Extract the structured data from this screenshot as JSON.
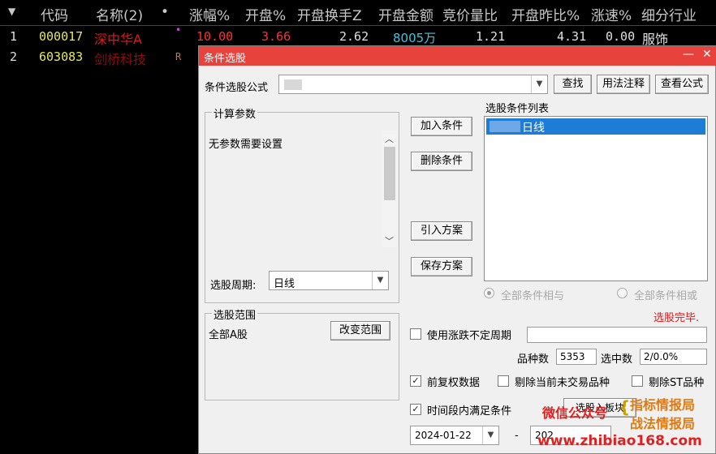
{
  "table": {
    "columns": [
      "代码",
      "名称(2)",
      "•",
      "涨幅%",
      "开盘%",
      "开盘换手Z",
      "开盘金额",
      "竞价量比",
      "开盘昨比%",
      "涨速%",
      "细分行业"
    ],
    "rows": [
      {
        "index": "1",
        "code": "000017",
        "name": "深中华A",
        "flag": "•",
        "change": "10.00",
        "open": "3.66",
        "turnover": "2.62",
        "amount": "8005万",
        "ratio": "1.21",
        "open_prev": "4.31",
        "speed": "0.00",
        "industry": "服饰"
      },
      {
        "index": "2",
        "code": "603083",
        "name": "剑桥科技",
        "flag": "R",
        "change": "",
        "open": "",
        "turnover": "",
        "amount": "",
        "ratio": "",
        "open_prev": "",
        "speed": "",
        "industry": ""
      }
    ],
    "sort_marker": "▼",
    "colors": {
      "code": "#e8e85a",
      "name1": "#e01818",
      "name2": "#8a0e0e",
      "change": "#ff3030",
      "amount": "#3ac8e0",
      "neutral": "#e0e0e0"
    }
  },
  "dialog": {
    "title": "条件选股",
    "minimize": "—",
    "close": "✕",
    "formula_label": "条件选股公式",
    "formula_value": "",
    "find_btn": "查找",
    "usage_btn": "用法注释",
    "view_btn": "查看公式",
    "params_title": "计算参数",
    "params_text": "无参数需要设置",
    "period_label": "选股周期:",
    "period_value": "日线",
    "add_btn": "加入条件",
    "del_btn": "删除条件",
    "import_btn": "引入方案",
    "save_btn": "保存方案",
    "cond_list_title": "选股条件列表",
    "cond_item": "日线",
    "radio_and": "全部条件相与",
    "radio_or": "全部条件相或",
    "status": "选股完毕.",
    "range_title": "选股范围",
    "range_value": "全部A股",
    "change_range_btn": "改变范围",
    "use_cycle": "使用涨跌不定周期",
    "count_label": "品种数",
    "count_value": "5353",
    "selected_label": "选中数",
    "selected_value": "2/0.0%",
    "adj_label": "前复权数据",
    "exclude_inactive": "剔除当前未交易品种",
    "exclude_st": "剔除ST品种",
    "time_label": "时间段内满足条件",
    "date_from": "2024-01-22",
    "date_sep": "-",
    "date_to": "202",
    "hidden_btn": "选股入板块"
  },
  "watermark": {
    "line1": "微信公众号",
    "line2": "指标情报局",
    "line3": "战法情报局",
    "url": "www.zhibiao168.com"
  }
}
